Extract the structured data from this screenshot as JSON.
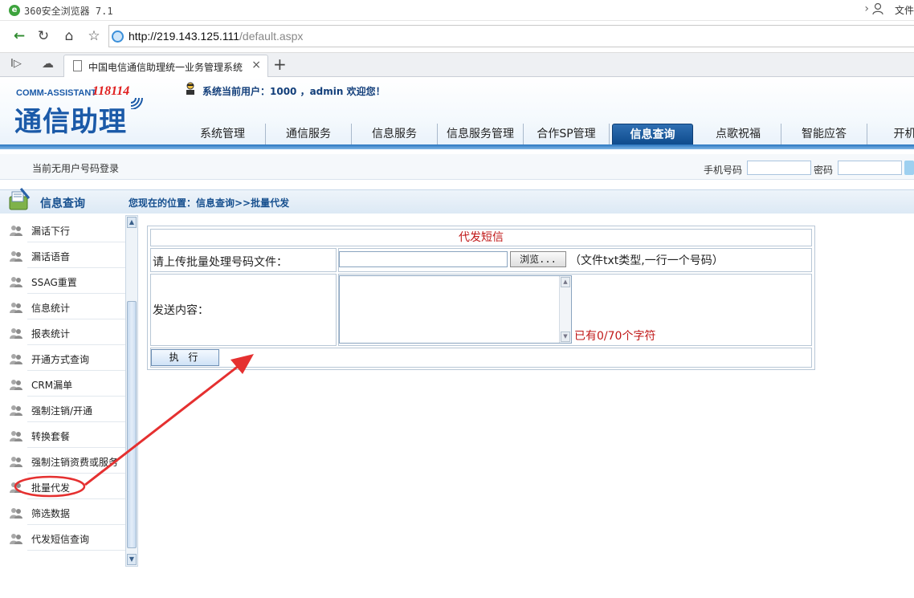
{
  "browser": {
    "title": "360安全浏览器 7.1",
    "menu_file": "文件",
    "url_host": "http://219.143.125.111",
    "url_path": "/default.aspx",
    "tab_title": "中国电信通信助理统一业务管理系统"
  },
  "header": {
    "brand_top": "COMM-ASSISTANT",
    "brand_number": "118114",
    "brand_name": "通信助理",
    "current_user_text": "系统当前用户：1000 ，admin 欢迎您！",
    "nav": [
      {
        "label": "系统管理",
        "active": false
      },
      {
        "label": "通信服务",
        "active": false
      },
      {
        "label": "信息服务",
        "active": false
      },
      {
        "label": "信息服务管理",
        "active": false
      },
      {
        "label": "合作SP管理",
        "active": false
      },
      {
        "label": "信息查询",
        "active": true
      },
      {
        "label": "点歌祝福",
        "active": false
      },
      {
        "label": "智能应答",
        "active": false
      },
      {
        "label": "开机提",
        "active": false
      }
    ]
  },
  "login": {
    "message": "当前无用户号码登录",
    "phone_label": "手机号码",
    "password_label": "密码"
  },
  "section": {
    "title": "信息查询",
    "breadcrumb": "您现在的位置：信息查询>>批量代发"
  },
  "sidebar": {
    "items": [
      "漏话下行",
      "漏话语音",
      "SSAG重置",
      "信息统计",
      "报表统计",
      "开通方式查询",
      "CRM漏单",
      "强制注销/开通",
      "转换套餐",
      "强制注销资费或服务",
      "批量代发",
      "筛选数据",
      "代发短信查询"
    ],
    "highlighted": "批量代发"
  },
  "form": {
    "title": "代发短信",
    "upload_label": "请上传批量处理号码文件：",
    "browse_label": "浏览...",
    "upload_hint": "（文件txt类型,一行一个号码）",
    "content_label": "发送内容：",
    "char_count": "已有0/70个字符",
    "execute_label": "执 行"
  },
  "colors": {
    "accent": "#17508f",
    "alert_red": "#c01818",
    "annotation_red": "#e53030"
  }
}
